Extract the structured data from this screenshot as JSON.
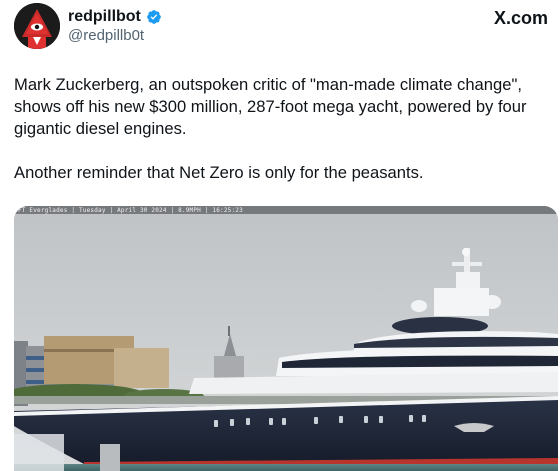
{
  "post": {
    "display_name": "redpillbot",
    "handle": "@redpillb0t",
    "platform_logo": "X.com",
    "paragraph_1": "Mark Zuckerberg, an outspoken critic of \"man-made climate change\", shows off his new $300 million, 287-foot mega yacht, powered by four gigantic diesel engines.",
    "paragraph_2": "Another reminder that Net Zero is only for the peasants."
  },
  "media": {
    "caption": "FT Everglades | Tuesday | April 30 2024 | 8.9MPH | 16:25:23",
    "subject": "mega yacht in harbor"
  },
  "icons": {
    "avatar": "pyramid-eye-avatar",
    "verified": "verified-badge-icon",
    "logo": "x-logo"
  },
  "colors": {
    "verified_blue": "#1d9bf0",
    "text": "#0f1419",
    "secondary_text": "#536471"
  }
}
